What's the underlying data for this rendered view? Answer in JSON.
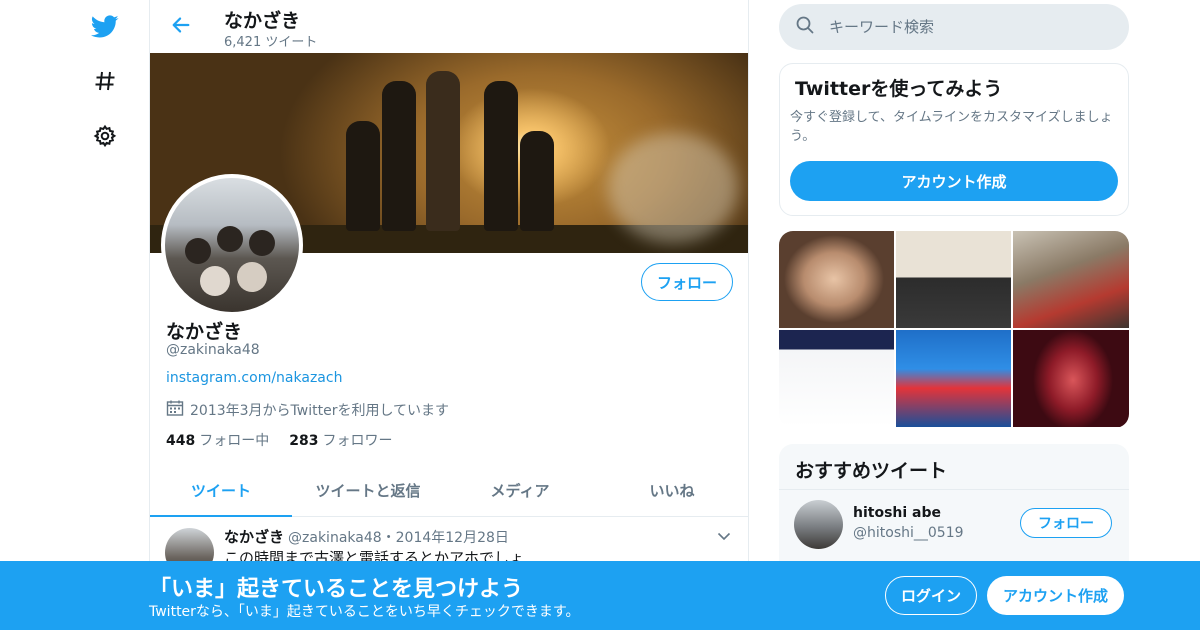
{
  "colors": {
    "accent": "#1da1f2",
    "text": "#14171a",
    "muted": "#657786",
    "border": "#e6ecf0"
  },
  "nav": {
    "icons": [
      "twitter-logo-icon",
      "hashtag-icon",
      "gear-icon"
    ]
  },
  "header": {
    "name": "なかざき",
    "tweet_count": "6,421 ツイート"
  },
  "profile": {
    "name": "なかざき",
    "handle": "@zakinaka48",
    "link": "instagram.com/nakazach",
    "joined": "2013年3月からTwitterを利用しています",
    "follow_label": "フォロー",
    "following_count": "448",
    "following_label": "フォロー中",
    "followers_count": "283",
    "followers_label": "フォロワー"
  },
  "tabs": [
    {
      "label": "ツイート",
      "active": true
    },
    {
      "label": "ツイートと返信",
      "active": false
    },
    {
      "label": "メディア",
      "active": false
    },
    {
      "label": "いいね",
      "active": false
    }
  ],
  "tweet": {
    "name": "なかざき",
    "meta": "@zakinaka48・2014年12月28日",
    "text": "この時間まで古澤と電話するとかアホでしょ"
  },
  "search": {
    "placeholder": "キーワード検索"
  },
  "signup_card": {
    "title": "Twitterを使ってみよう",
    "text": "今すぐ登録して、タイムラインをカスタマイズしましょう。",
    "button": "アカウント作成"
  },
  "recommend": {
    "title": "おすすめツイート",
    "name": "hitoshi abe",
    "handle": "@hitoshi__0519",
    "follow_label": "フォロー"
  },
  "bottom_bar": {
    "title": "「いま」起きていることを見つけよう",
    "subtitle": "Twitterなら、「いま」起きていることをいち早くチェックできます。",
    "login": "ログイン",
    "signup": "アカウント作成"
  }
}
